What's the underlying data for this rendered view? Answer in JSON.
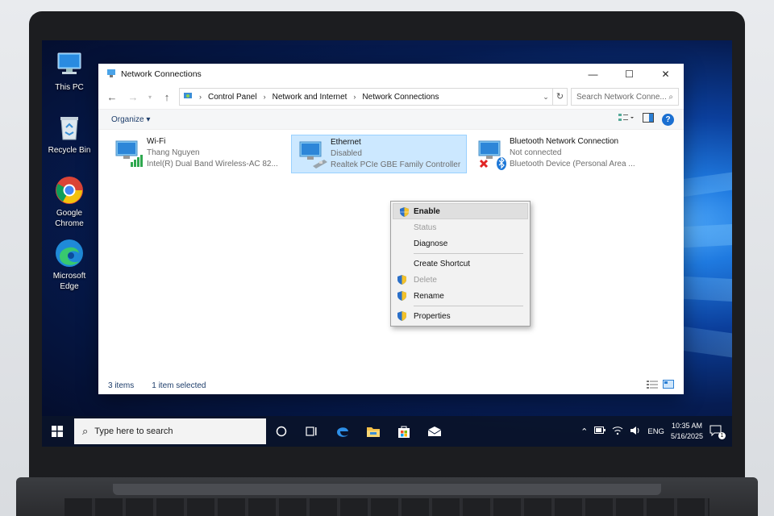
{
  "colors": {
    "accent": "#1a6fd1",
    "selection": "#cce8ff",
    "desktop": "#0b3f9c"
  },
  "desktop_icons": [
    {
      "label": "This PC",
      "icon": "monitor-icon"
    },
    {
      "label": "Recycle Bin",
      "icon": "recycle-bin-icon"
    },
    {
      "label": "Google Chrome",
      "icon": "chrome-icon"
    },
    {
      "label": "Microsoft Edge",
      "icon": "edge-icon"
    }
  ],
  "window": {
    "title": "Network Connections",
    "controls": {
      "minimize": "—",
      "maximize": "☐",
      "close": "✕"
    },
    "breadcrumb": [
      "Control Panel",
      "Network and Internet",
      "Network Connections"
    ],
    "search_placeholder": "Search Network Conne...",
    "organize_label": "Organize",
    "adapters": [
      {
        "name": "Wi-Fi",
        "status": "Thang Nguyen",
        "device": "Intel(R) Dual Band Wireless-AC 82...",
        "selected": false
      },
      {
        "name": "Ethernet",
        "status": "Disabled",
        "device": "Realtek PCIe GBE Family Controller",
        "selected": true
      },
      {
        "name": "Bluetooth Network Connection",
        "status": "Not connected",
        "device": "Bluetooth Device (Personal Area ...",
        "selected": false
      }
    ],
    "status": {
      "items": "3 items",
      "selected": "1 item selected"
    }
  },
  "context_menu": {
    "items": [
      {
        "label": "Enable",
        "shield": true,
        "state": "highlighted"
      },
      {
        "label": "Status",
        "shield": false,
        "state": "disabled"
      },
      {
        "label": "Diagnose",
        "shield": false,
        "state": "normal"
      },
      {
        "label": "Create Shortcut",
        "shield": false,
        "state": "normal"
      },
      {
        "label": "Delete",
        "shield": true,
        "state": "disabled"
      },
      {
        "label": "Rename",
        "shield": true,
        "state": "normal"
      },
      {
        "label": "Properties",
        "shield": true,
        "state": "normal"
      }
    ]
  },
  "taskbar": {
    "search_placeholder": "Type here to search",
    "language": "ENG",
    "time": "10:35 AM",
    "date": "5/16/2025",
    "notification_count": "1"
  }
}
